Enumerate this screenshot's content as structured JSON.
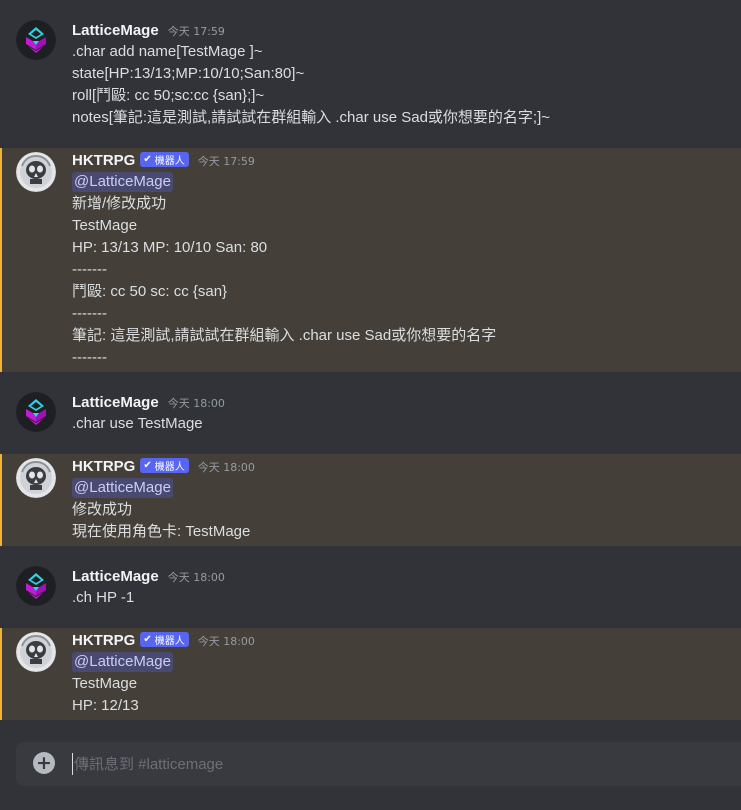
{
  "channel": {
    "input_placeholder": "傳訊息到 #latticemage"
  },
  "colors": {
    "background": "#313338",
    "mention_highlight": "#444039",
    "mention_bar": "#f0b232",
    "bot_badge": "#5865f2",
    "mention_pill_text": "#c9cdfb"
  },
  "messages": [
    {
      "author": "LatticeMage",
      "avatar": "lattice-mage-logo",
      "timestamp": "今天 17:59",
      "lines": [
        ".char add name[TestMage ]~",
        "state[HP:13/13;MP:10/10;San:80]~",
        "roll[鬥毆: cc 50;sc:cc {san};]~",
        "notes[筆記:這是測試,請試試在群組輸入 .char use Sad或你想要的名字;]~"
      ]
    },
    {
      "author": "HKTRPG",
      "avatar": "hktrpg-skull-logo",
      "badge": "機器人",
      "timestamp": "今天 17:59",
      "mention": "@LatticeMage",
      "lines": [
        "新增/修改成功",
        "TestMage",
        "HP: 13/13 MP: 10/10 San: 80",
        "-------",
        "鬥毆: cc 50  sc: cc {san}",
        "-------",
        "筆記: 這是測試,請試試在群組輸入 .char use Sad或你想要的名字",
        "-------"
      ]
    },
    {
      "author": "LatticeMage",
      "avatar": "lattice-mage-logo",
      "timestamp": "今天 18:00",
      "lines": [
        ".char use TestMage"
      ]
    },
    {
      "author": "HKTRPG",
      "avatar": "hktrpg-skull-logo",
      "badge": "機器人",
      "timestamp": "今天 18:00",
      "mention": "@LatticeMage",
      "lines": [
        "修改成功",
        "現在使用角色卡: TestMage"
      ]
    },
    {
      "author": "LatticeMage",
      "avatar": "lattice-mage-logo",
      "timestamp": "今天 18:00",
      "lines": [
        ".ch HP -1"
      ]
    },
    {
      "author": "HKTRPG",
      "avatar": "hktrpg-skull-logo",
      "badge": "機器人",
      "timestamp": "今天 18:00",
      "mention": "@LatticeMage",
      "lines": [
        "TestMage",
        "HP: 12/13"
      ]
    }
  ]
}
